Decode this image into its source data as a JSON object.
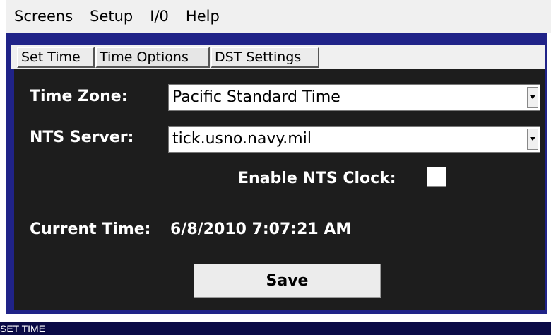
{
  "menu": {
    "items": [
      {
        "label": "Screens"
      },
      {
        "label": "Setup"
      },
      {
        "label": "I/0"
      },
      {
        "label": "Help"
      }
    ]
  },
  "tabs": [
    {
      "label": "Set Time",
      "active": false
    },
    {
      "label": "Time Options",
      "active": true
    },
    {
      "label": "DST Settings",
      "active": false
    }
  ],
  "form": {
    "time_zone_label": "Time Zone:",
    "time_zone_value": "Pacific Standard Time",
    "nts_server_label": "NTS Server:",
    "nts_server_value": "tick.usno.navy.mil",
    "enable_nts_label": "Enable NTS Clock:",
    "enable_nts_checked": false,
    "current_time_label": "Current Time:",
    "current_time_value": "6/8/2010 7:07:21 AM",
    "save_label": "Save"
  },
  "status": {
    "text": "SET TIME"
  },
  "icons": {
    "dropdown": "chevron-down-icon"
  },
  "colors": {
    "frame": "#202388",
    "panel": "#1d1d1d",
    "status_bar": "#0a0a46"
  }
}
